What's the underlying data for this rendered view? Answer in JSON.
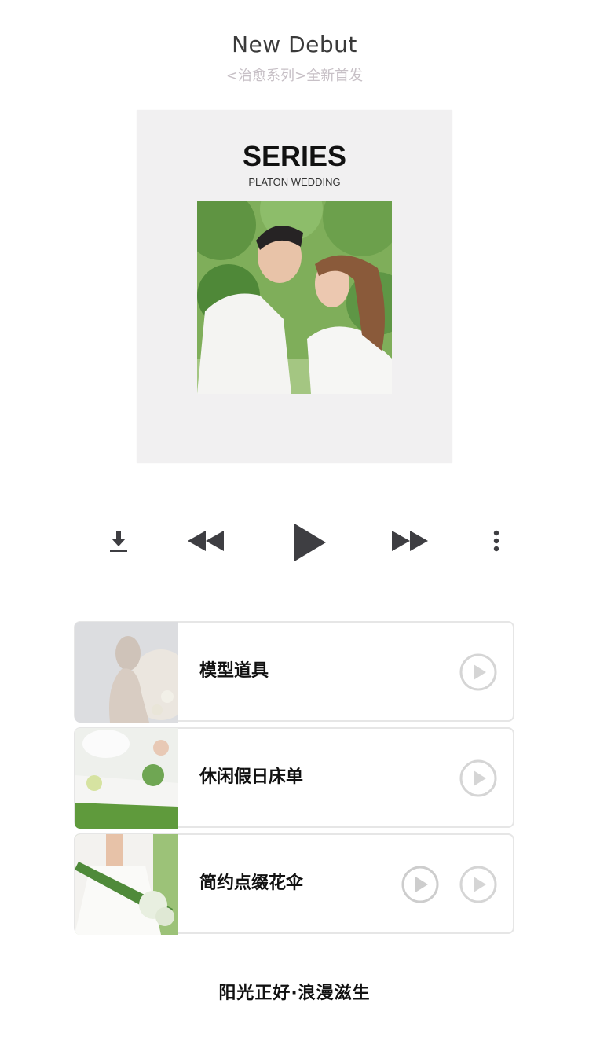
{
  "header": {
    "title": "New Debut",
    "subtitle": "<治愈系列>全新首发"
  },
  "album": {
    "title": "SERIES",
    "subtitle": "PLATON WEDDING"
  },
  "controls": {
    "download_icon": "download-icon",
    "rewind_icon": "rewind-icon",
    "play_icon": "play-icon",
    "fast_forward_icon": "fast-forward-icon",
    "more_icon": "more-vertical-icon"
  },
  "tracks": [
    {
      "label": "模型道具"
    },
    {
      "label": "休闲假日床单"
    },
    {
      "label": "简约点缀花伞"
    }
  ],
  "footer": {
    "text": "阳光正好·浪漫滋生"
  },
  "colors": {
    "text_dark": "#111111",
    "subtitle_gray": "#c7c0c6",
    "control_gray": "#3e3e42",
    "card_border": "#e6e6e6"
  }
}
